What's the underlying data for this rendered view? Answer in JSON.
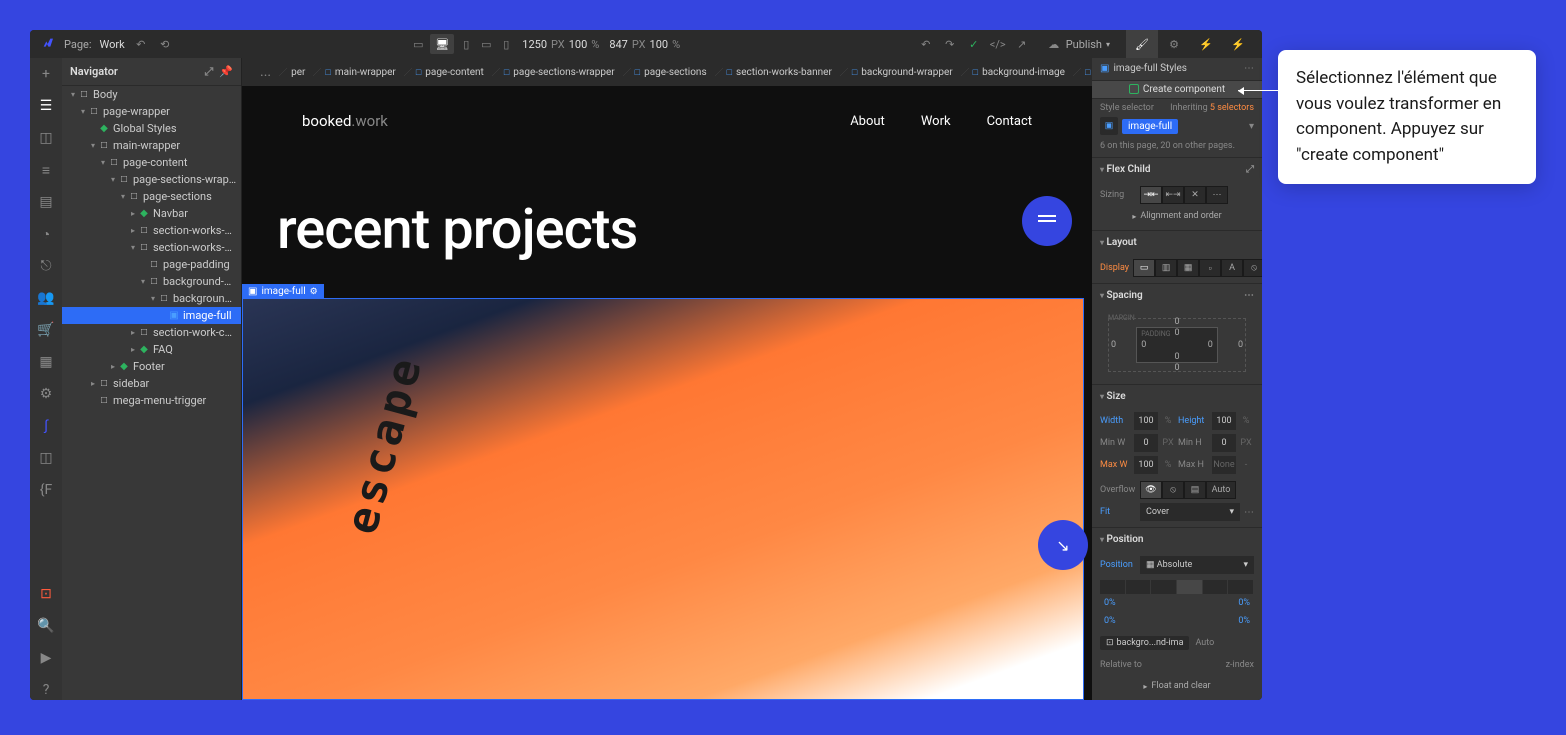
{
  "topbar": {
    "page_label": "Page:",
    "page_name": "Work",
    "width": "1250",
    "width_unit": "PX",
    "zoom": "100",
    "zoom_unit": "%",
    "height": "847",
    "height_unit": "PX",
    "zoom2": "100",
    "zoom2_unit": "%",
    "publish": "Publish"
  },
  "navigator": {
    "title": "Navigator",
    "items": [
      {
        "label": "Body",
        "indent": 0,
        "arrow": "▾",
        "icon": "□",
        "cls": ""
      },
      {
        "label": "page-wrapper",
        "indent": 1,
        "arrow": "▾",
        "icon": "□",
        "cls": ""
      },
      {
        "label": "Global Styles",
        "indent": 2,
        "arrow": "",
        "icon": "◆",
        "cls": "green"
      },
      {
        "label": "main-wrapper",
        "indent": 2,
        "arrow": "▾",
        "icon": "□",
        "cls": ""
      },
      {
        "label": "page-content",
        "indent": 3,
        "arrow": "▾",
        "icon": "□",
        "cls": ""
      },
      {
        "label": "page-sections-wrapper",
        "indent": 4,
        "arrow": "▾",
        "icon": "□",
        "cls": ""
      },
      {
        "label": "page-sections",
        "indent": 5,
        "arrow": "▾",
        "icon": "□",
        "cls": ""
      },
      {
        "label": "Navbar",
        "indent": 6,
        "arrow": "▸",
        "icon": "◆",
        "cls": "green"
      },
      {
        "label": "section-works-hero",
        "indent": 6,
        "arrow": "▸",
        "icon": "□",
        "cls": ""
      },
      {
        "label": "section-works-banner",
        "indent": 6,
        "arrow": "▾",
        "icon": "□",
        "cls": ""
      },
      {
        "label": "page-padding",
        "indent": 7,
        "arrow": "",
        "icon": "□",
        "cls": ""
      },
      {
        "label": "background-wra...",
        "indent": 7,
        "arrow": "▾",
        "icon": "□",
        "cls": ""
      },
      {
        "label": "background-image",
        "indent": 8,
        "arrow": "▾",
        "icon": "□",
        "cls": ""
      },
      {
        "label": "image-full",
        "indent": 9,
        "arrow": "",
        "icon": "▣",
        "cls": "blue",
        "selected": true
      },
      {
        "label": "section-work-cms",
        "indent": 6,
        "arrow": "▸",
        "icon": "□",
        "cls": ""
      },
      {
        "label": "FAQ",
        "indent": 6,
        "arrow": "▸",
        "icon": "◆",
        "cls": "green"
      },
      {
        "label": "Footer",
        "indent": 4,
        "arrow": "▸",
        "icon": "◆",
        "cls": "green"
      },
      {
        "label": "sidebar",
        "indent": 2,
        "arrow": "▸",
        "icon": "□",
        "cls": ""
      },
      {
        "label": "mega-menu-trigger",
        "indent": 2,
        "arrow": "",
        "icon": "□",
        "cls": ""
      }
    ]
  },
  "breadcrumb": [
    "...",
    "per",
    "main-wrapper",
    "page-content",
    "page-sections-wrapper",
    "page-sections",
    "section-works-banner",
    "background-wrapper",
    "background-image",
    "image-full"
  ],
  "site": {
    "logo_bold": "booked",
    "logo_grey": ".work",
    "nav": [
      "About",
      "Work",
      "Contact"
    ],
    "title": "recent projects",
    "sel_label": "image-full"
  },
  "styles": {
    "header": "image-full Styles",
    "create": "Create component",
    "selector_label": "Style selector",
    "inheriting": "Inheriting",
    "inheriting_count": "5 selectors",
    "chip": "image-full",
    "count": "6 on this page, 20 on other pages.",
    "flex": {
      "title": "Flex Child",
      "sizing": "Sizing",
      "align": "Alignment and order"
    },
    "layout": {
      "title": "Layout",
      "display": "Display"
    },
    "spacing": {
      "title": "Spacing",
      "margin": "MARGIN",
      "padding": "PADDING",
      "vals": {
        "t": "0",
        "r": "0",
        "b": "0",
        "l": "0",
        "pt": "0",
        "pr": "0",
        "pb": "0",
        "pl": "0"
      }
    },
    "size": {
      "title": "Size",
      "w": "Width",
      "wv": "100",
      "wu": "%",
      "h": "Height",
      "hv": "100",
      "hu": "%",
      "minw": "Min W",
      "minwv": "0",
      "minwu": "PX",
      "minh": "Min H",
      "minhv": "0",
      "minhu": "PX",
      "maxw": "Max W",
      "maxwv": "100",
      "maxwu": "%",
      "maxh": "Max H",
      "maxhv": "None",
      "maxhu": "-",
      "overflow": "Overflow",
      "auto": "Auto",
      "fit": "Fit",
      "fitv": "Cover"
    },
    "position": {
      "title": "Position",
      "label": "Position",
      "value": "Absolute",
      "tl": "0%",
      "tr": "0%",
      "bl": "0%",
      "br": "0%",
      "rel": "Relative to",
      "relv": "backgro...nd-ima",
      "relauto": "Auto",
      "zindex": "z-index",
      "float": "Float and clear"
    }
  },
  "callout": {
    "text": "Sélectionnez l'élément que vous voulez transformer en component. Appuyez sur \"create component\""
  }
}
